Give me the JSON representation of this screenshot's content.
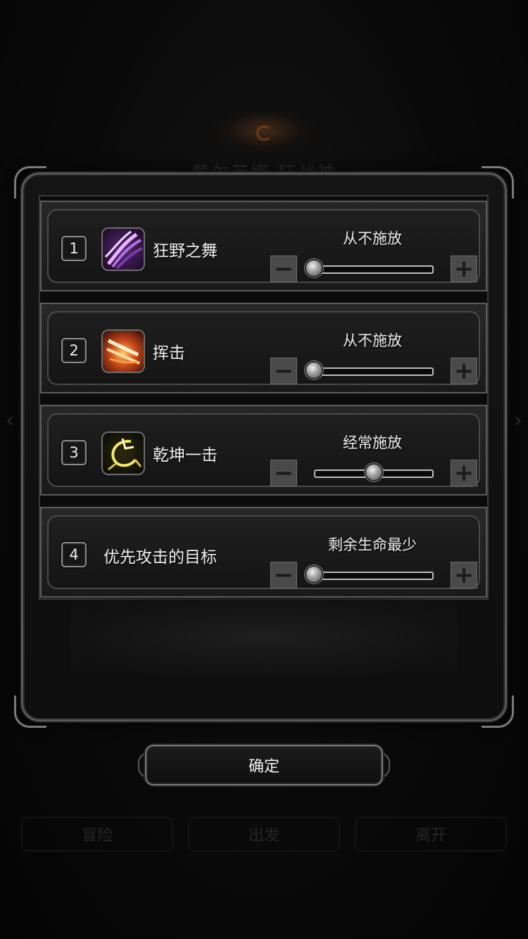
{
  "background": {
    "title": "戴尔芙娜 狂战神",
    "tabs": [
      "冒险",
      "出发",
      "离开"
    ]
  },
  "skills": [
    {
      "number": "1",
      "name": "狂野之舞",
      "icon": "wild-dance-icon",
      "state": "从不施放",
      "level": 0.0
    },
    {
      "number": "2",
      "name": "挥击",
      "icon": "swing-strike-icon",
      "state": "从不施放",
      "level": 0.0
    },
    {
      "number": "3",
      "name": "乾坤一击",
      "icon": "cosmic-strike-icon",
      "state": "经常施放",
      "level": 0.5
    }
  ],
  "target": {
    "number": "4",
    "name": "优先攻击的目标",
    "state": "剩余生命最少",
    "level": 0.0
  },
  "confirm_label": "确定",
  "colors": {
    "panel_border": "#595959",
    "text": "#f0f0f0",
    "button": "#4a4a4a"
  }
}
